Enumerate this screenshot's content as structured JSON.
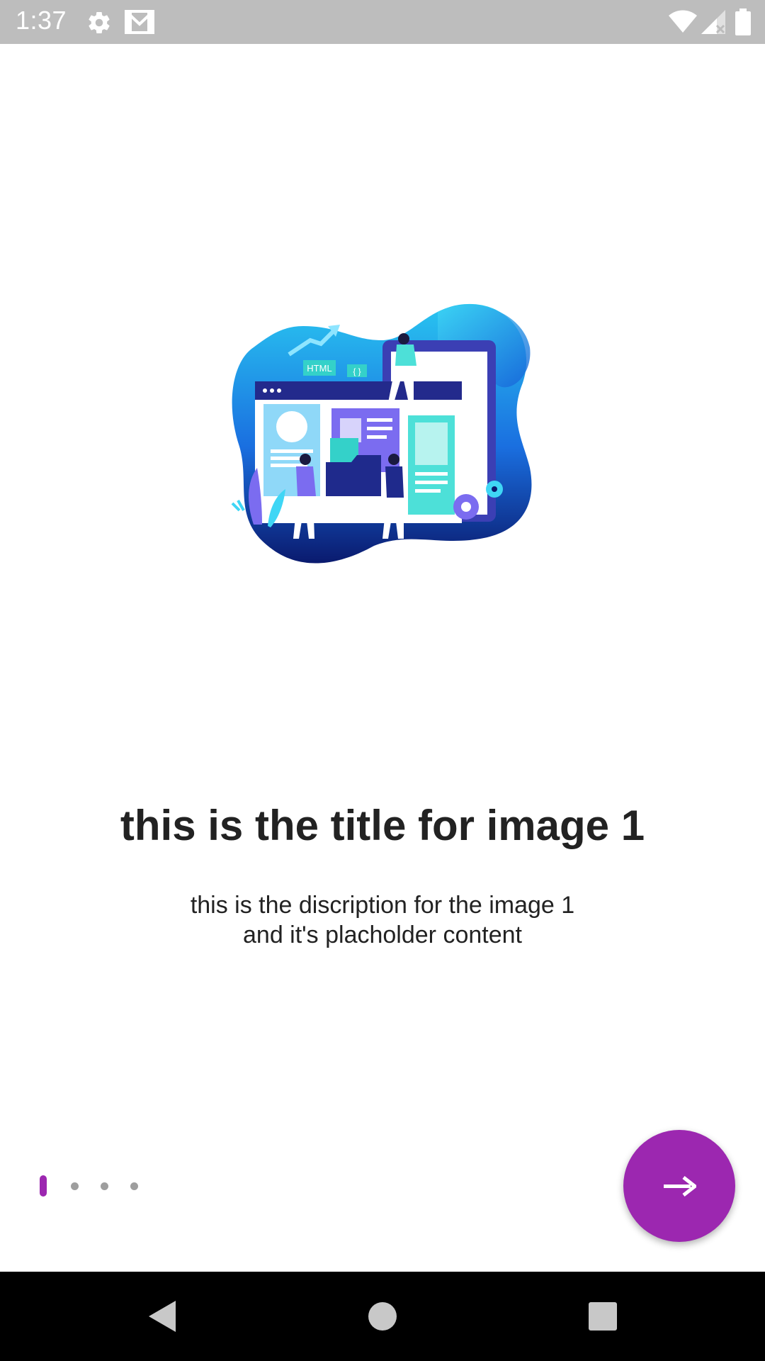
{
  "status_bar": {
    "time": "1:37",
    "icons": [
      "settings-icon",
      "gmail-icon",
      "wifi-icon",
      "signal-icon",
      "battery-icon"
    ]
  },
  "onboarding": {
    "illustration": "web-development-illustration",
    "illustration_label": "HTML",
    "illustration_code": "{ }",
    "title": "this is the title for image 1",
    "description_line1": "this is the discription for the image 1",
    "description_line2": "and it's placholder content",
    "page_count": 4,
    "current_page": 1
  },
  "fab": {
    "icon": "arrow-right-icon"
  },
  "nav_bar": {
    "buttons": [
      "back-icon",
      "home-icon",
      "recents-icon"
    ]
  },
  "colors": {
    "accent": "#9c27b0",
    "status_bar": "#bdbdbd",
    "nav_bar": "#000000",
    "text": "#222222",
    "dot_inactive": "#9e9e9e"
  }
}
